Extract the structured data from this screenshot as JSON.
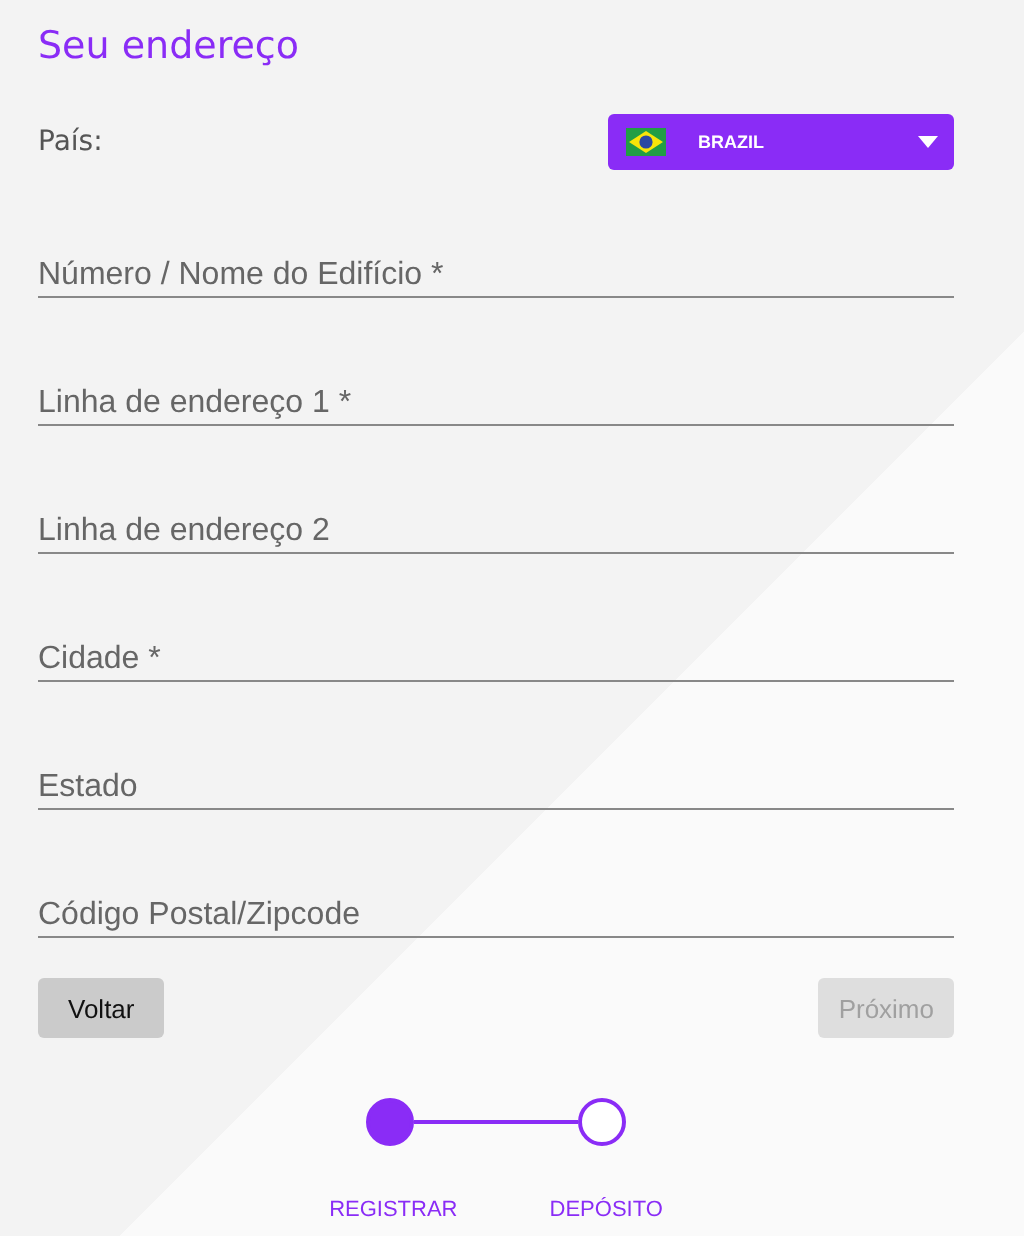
{
  "title": "Seu endereço",
  "country": {
    "label": "País:",
    "value": "BRAZIL"
  },
  "fields": [
    {
      "placeholder": "Número / Nome do Edifício *"
    },
    {
      "placeholder": "Linha de endereço 1 *"
    },
    {
      "placeholder": "Linha de endereço 2"
    },
    {
      "placeholder": "Cidade *"
    },
    {
      "placeholder": "Estado"
    },
    {
      "placeholder": "Código Postal/Zipcode"
    }
  ],
  "buttons": [
    {
      "label": "Voltar",
      "disabled": false
    },
    {
      "label": "Próximo",
      "disabled": true
    }
  ],
  "steps": [
    {
      "label": "REGISTRAR",
      "completed": true
    },
    {
      "label": "DEPÓSITO",
      "completed": false
    }
  ]
}
